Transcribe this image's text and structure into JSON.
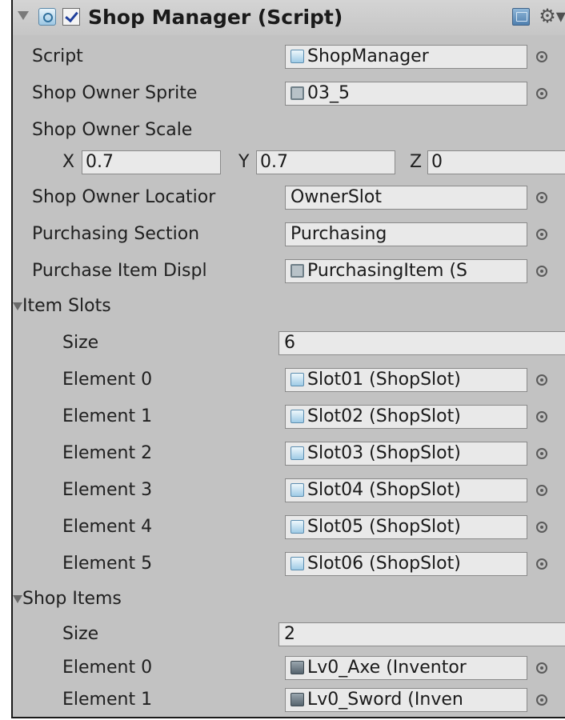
{
  "component": {
    "title": "Shop Manager (Script)",
    "enabled": true,
    "icons": [
      "script-component-icon",
      "help-icon",
      "gear-icon"
    ]
  },
  "fields": {
    "script": {
      "label": "Script",
      "value": "ShopManager",
      "icon": "script-icon"
    },
    "shop_owner_sprite": {
      "label": "Shop Owner Sprite",
      "value": "03_5",
      "icon": "sprite-icon"
    },
    "shop_owner_scale": {
      "label": "Shop Owner Scale",
      "x_label": "X",
      "x": "0.7",
      "y_label": "Y",
      "y": "0.7",
      "z_label": "Z",
      "z": "0"
    },
    "shop_owner_location": {
      "label": "Shop Owner Locatior",
      "value": "OwnerSlot"
    },
    "purchasing_section": {
      "label": "Purchasing Section",
      "value": "Purchasing"
    },
    "purchase_item_display": {
      "label": "Purchase Item Displ",
      "value": "PurchasingItem (S",
      "icon": "prefab-icon"
    }
  },
  "item_slots": {
    "label": "Item Slots",
    "size_label": "Size",
    "size": "6",
    "elements": [
      {
        "label": "Element 0",
        "value": "Slot01 (ShopSlot)"
      },
      {
        "label": "Element 1",
        "value": "Slot02 (ShopSlot)"
      },
      {
        "label": "Element 2",
        "value": "Slot03 (ShopSlot)"
      },
      {
        "label": "Element 3",
        "value": "Slot04 (ShopSlot)"
      },
      {
        "label": "Element 4",
        "value": "Slot05 (ShopSlot)"
      },
      {
        "label": "Element 5",
        "value": "Slot06 (ShopSlot)"
      }
    ]
  },
  "shop_items": {
    "label": "Shop Items",
    "size_label": "Size",
    "size": "2",
    "elements": [
      {
        "label": "Element 0",
        "value": "Lv0_Axe (Inventor"
      },
      {
        "label": "Element 1",
        "value": "Lv0_Sword (Inven"
      }
    ]
  }
}
